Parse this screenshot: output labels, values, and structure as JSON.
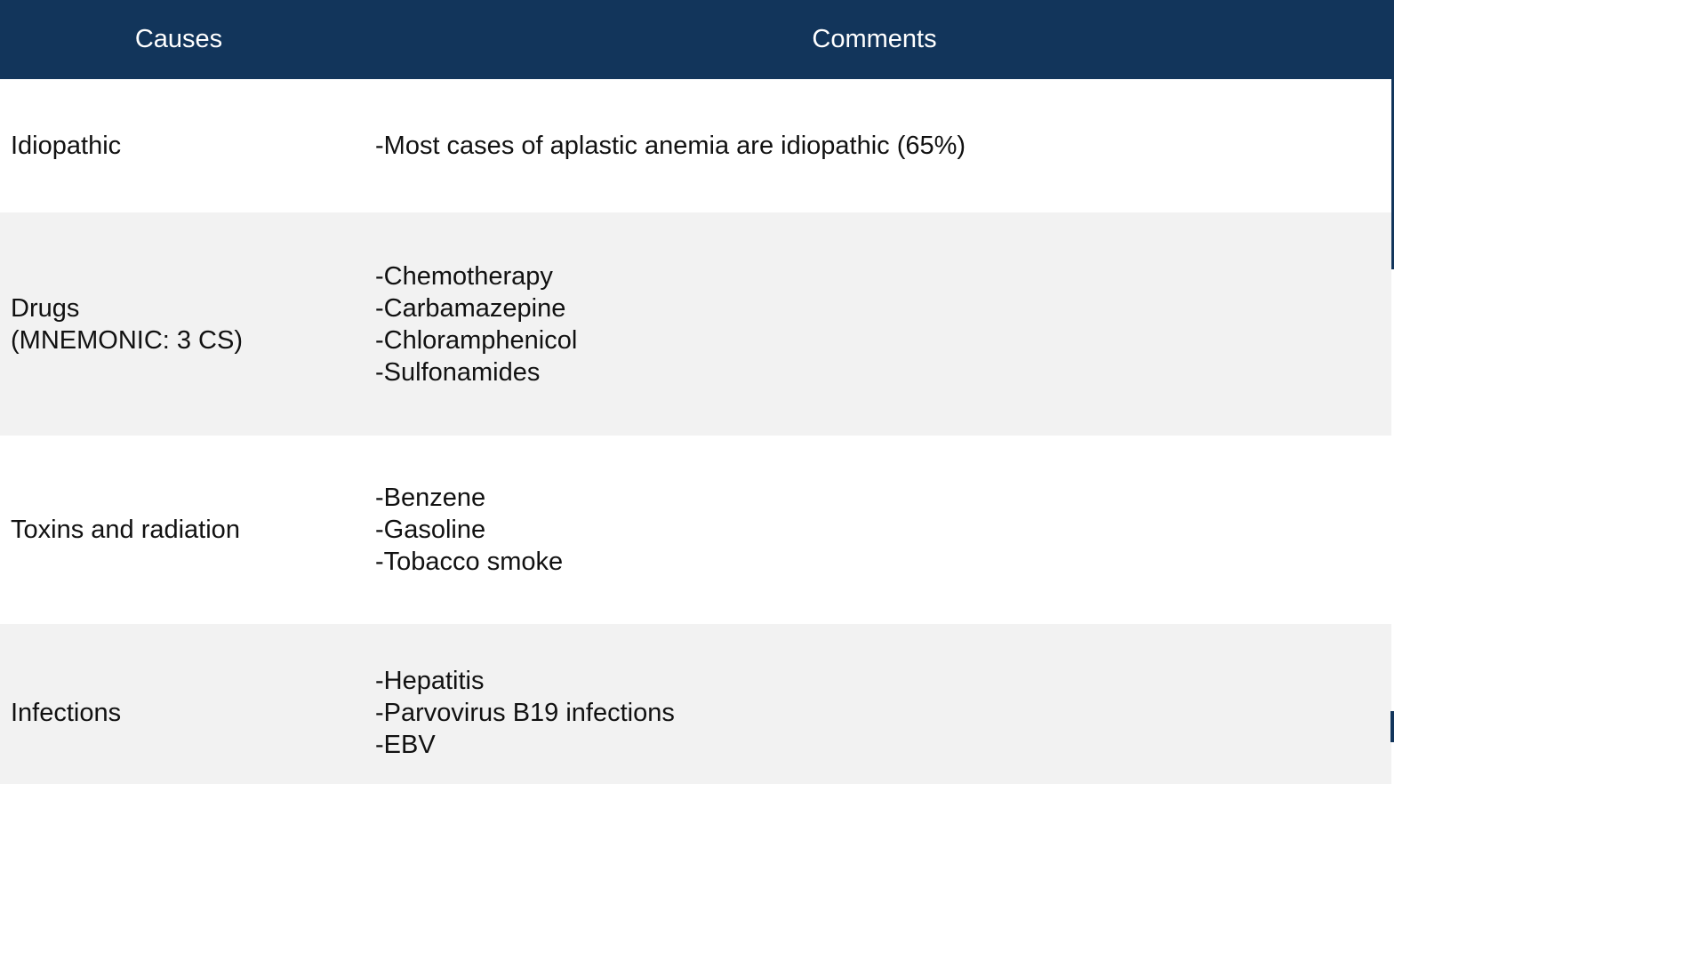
{
  "table": {
    "headers": {
      "causes": "Causes",
      "comments": "Comments"
    },
    "rows": [
      {
        "cause": [
          "Idiopathic"
        ],
        "comments": [
          "-Most cases of aplastic anemia are idiopathic (65%)"
        ]
      },
      {
        "cause": [
          "Drugs",
          "(MNEMONIC: 3 CS)"
        ],
        "comments": [
          "-Chemotherapy",
          "-Carbamazepine",
          "-Chloramphenicol",
          "-Sulfonamides"
        ]
      },
      {
        "cause": [
          "Toxins and radiation"
        ],
        "comments": [
          "-Benzene",
          "-Gasoline",
          "-Tobacco smoke"
        ]
      },
      {
        "cause": [
          "Infections"
        ],
        "comments": [
          "-Hepatitis",
          "-Parvovirus B19 infections",
          "-EBV"
        ]
      }
    ]
  },
  "colors": {
    "header_bg": "#12355b",
    "header_text": "#ffffff",
    "row_alt_bg": "#f2f2f2"
  }
}
